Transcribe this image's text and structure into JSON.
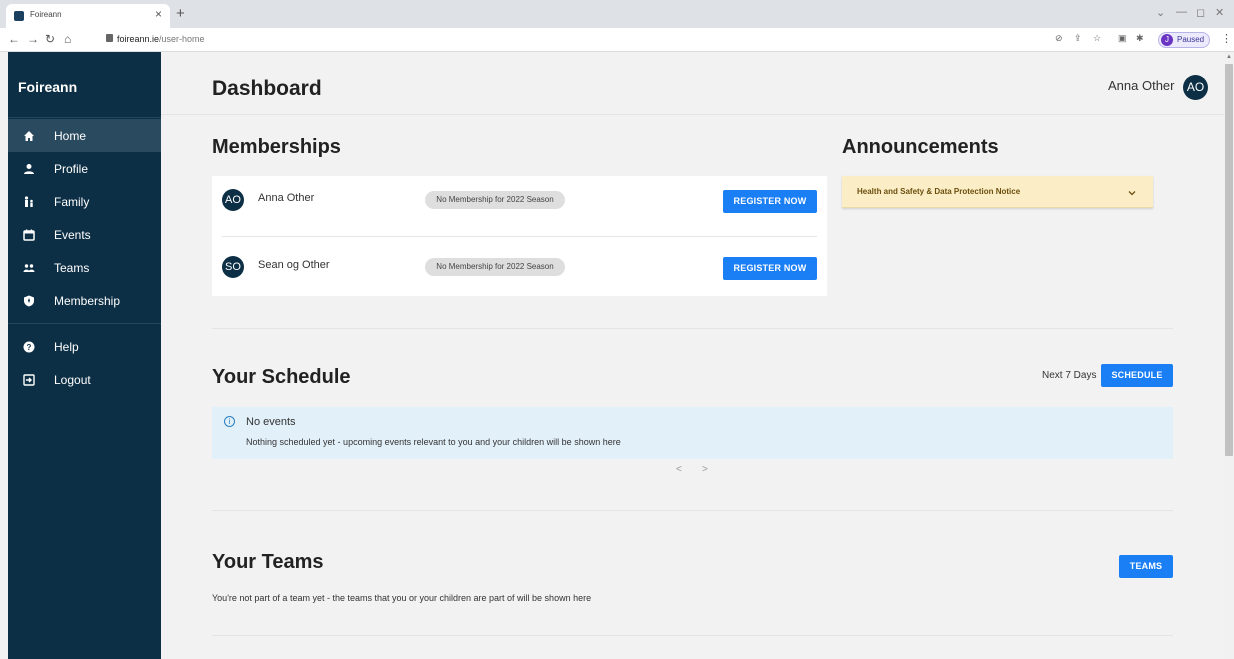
{
  "browser": {
    "tab_title": "Foireann",
    "tab_close": "×",
    "new_tab": "+",
    "url_host": "foireann.ie",
    "url_path": "/user-home",
    "profile_initial": "J",
    "profile_status": "Paused",
    "window_controls": [
      "⌄",
      "—",
      "◻",
      "✕"
    ]
  },
  "sidebar": {
    "brand": "Foireann",
    "items": [
      {
        "label": "Home",
        "icon": "home-icon",
        "active": true
      },
      {
        "label": "Profile",
        "icon": "person-icon",
        "active": false
      },
      {
        "label": "Family",
        "icon": "family-icon",
        "active": false
      },
      {
        "label": "Events",
        "icon": "calendar-icon",
        "active": false
      },
      {
        "label": "Teams",
        "icon": "group-icon",
        "active": false
      },
      {
        "label": "Membership",
        "icon": "shield-icon",
        "active": false
      }
    ],
    "secondary_items": [
      {
        "label": "Help",
        "icon": "help-icon"
      },
      {
        "label": "Logout",
        "icon": "logout-icon"
      }
    ]
  },
  "header": {
    "title": "Dashboard",
    "user_name": "Anna Other",
    "user_initials": "AO"
  },
  "memberships": {
    "title": "Memberships",
    "rows": [
      {
        "initials": "AO",
        "name": "Anna Other",
        "status": "No Membership for 2022 Season",
        "action": "REGISTER NOW"
      },
      {
        "initials": "SO",
        "name": "Sean og Other",
        "status": "No Membership for 2022 Season",
        "action": "REGISTER NOW"
      }
    ]
  },
  "announcements": {
    "title": "Announcements",
    "items": [
      {
        "title": "Health and Safety & Data Protection Notice"
      }
    ]
  },
  "schedule": {
    "title": "Your Schedule",
    "range": "Next 7 Days",
    "button": "SCHEDULE",
    "empty_title": "No events",
    "empty_text": "Nothing scheduled yet - upcoming events relevant to you and your children will be shown here",
    "prev": "<",
    "next": ">"
  },
  "teams": {
    "title": "Your Teams",
    "button": "TEAMS",
    "empty_text": "You're not part of a team yet - the teams that you or your children are part of will be shown here"
  },
  "colors": {
    "sidebar_bg": "#0d2f45",
    "sidebar_active": "#2a4a5f",
    "primary_button": "#1a7ff5",
    "announcement_bg": "#fbeec6",
    "info_bg": "#e2f0fa"
  }
}
